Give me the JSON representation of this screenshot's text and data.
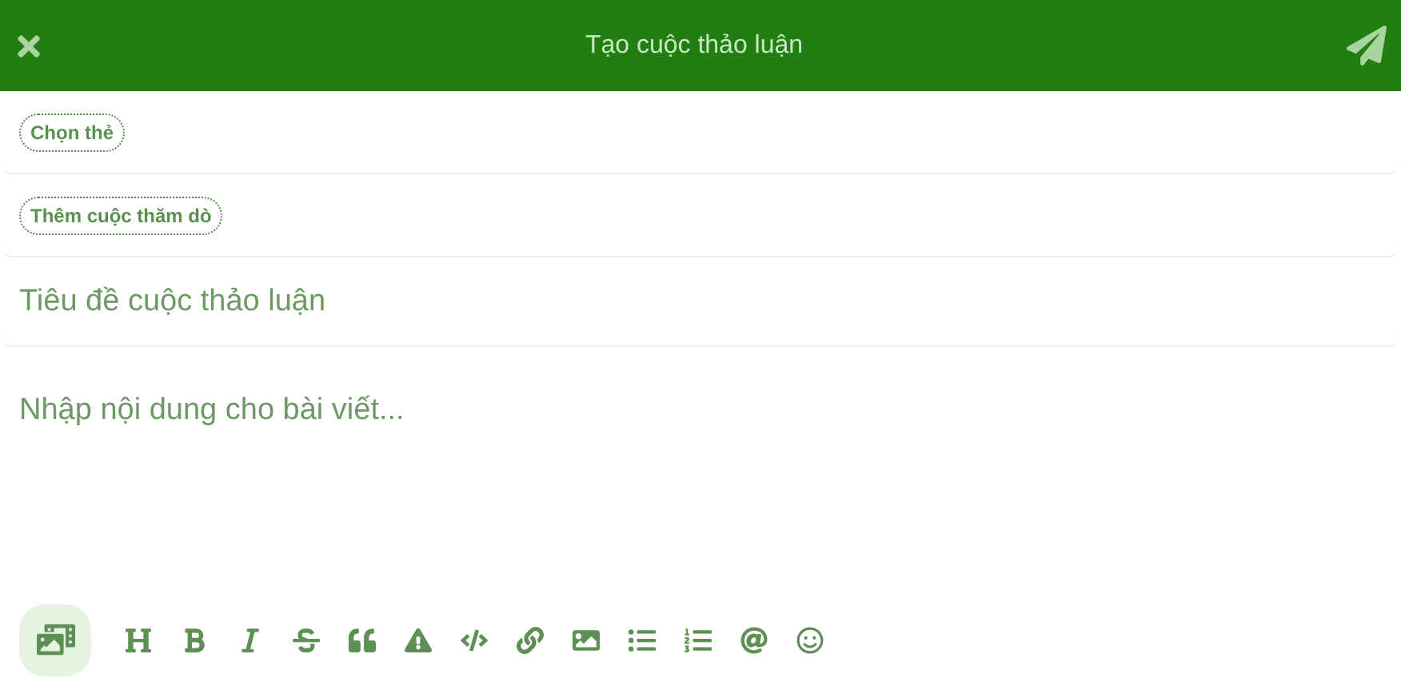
{
  "header": {
    "title": "Tạo cuộc thảo luận"
  },
  "tags_button": {
    "label": "Chọn thẻ"
  },
  "poll_button": {
    "label": "Thêm cuộc thăm dò"
  },
  "title_field": {
    "placeholder": "Tiêu đề cuộc thảo luận"
  },
  "body_field": {
    "placeholder": "Nhập nội dung cho bài viết..."
  },
  "toolbar": [
    {
      "kind": "media",
      "selected": true
    },
    {
      "kind": "heading",
      "selected": false
    },
    {
      "kind": "bold",
      "selected": false
    },
    {
      "kind": "italic",
      "selected": false
    },
    {
      "kind": "strike",
      "selected": false
    },
    {
      "kind": "quote",
      "selected": false
    },
    {
      "kind": "spoiler",
      "selected": false
    },
    {
      "kind": "code",
      "selected": false
    },
    {
      "kind": "link",
      "selected": false
    },
    {
      "kind": "image",
      "selected": false
    },
    {
      "kind": "bullets",
      "selected": false
    },
    {
      "kind": "numbers",
      "selected": false
    },
    {
      "kind": "mention",
      "selected": false
    },
    {
      "kind": "emoji",
      "selected": false
    }
  ]
}
